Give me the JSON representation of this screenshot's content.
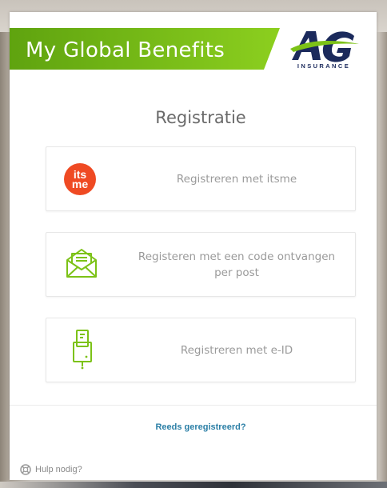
{
  "header": {
    "title": "My Global Benefits",
    "logo_text": "AG",
    "logo_subtext": "INSURANCE",
    "brand_color": "#7cc217",
    "logo_color": "#1b2a5c"
  },
  "main": {
    "title": "Registratie",
    "options": [
      {
        "label": "Registreren met itsme",
        "icon": "itsme-icon",
        "icon_text_top": "its",
        "icon_text_bottom": "me"
      },
      {
        "label": "Registeren met een code ontvangen per post",
        "icon": "envelope-letter-icon"
      },
      {
        "label": "Registreren met e-ID",
        "icon": "eid-card-reader-icon"
      }
    ]
  },
  "footer": {
    "login_link": "Reeds geregistreerd?",
    "help_text": "Hulp nodig?",
    "help_icon": "lifebuoy-icon",
    "link_color": "#2b7fa6"
  }
}
